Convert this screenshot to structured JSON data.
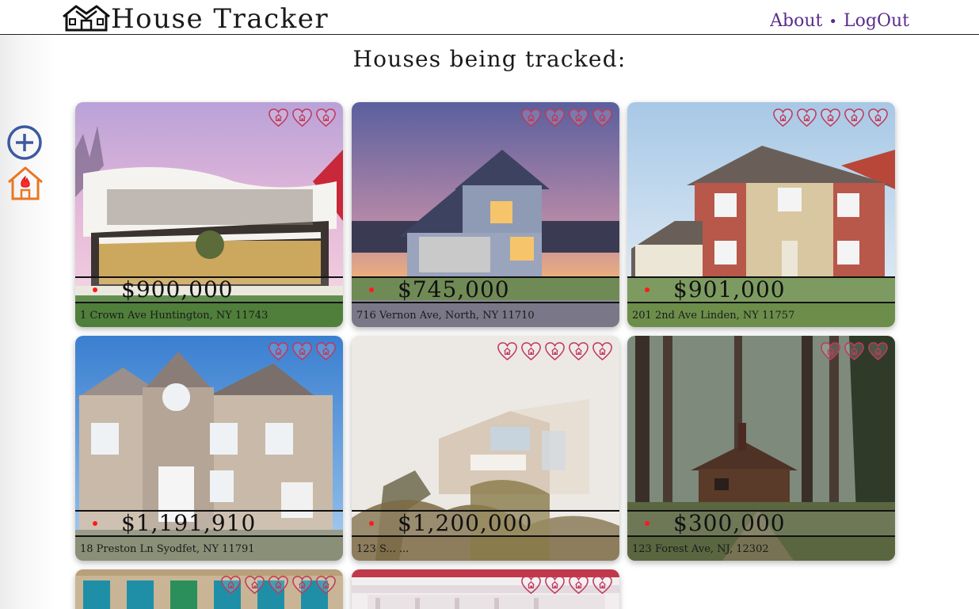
{
  "app": {
    "title": "House Tracker"
  },
  "nav": {
    "about": "About",
    "separator": "•",
    "logout": "LogOut"
  },
  "page_title": "Houses being tracked:",
  "side_buttons": {
    "add_icon": "plus-circle-icon",
    "fire_icon": "house-fire-icon"
  },
  "colors": {
    "nav": "#5a2e8a",
    "heart": "#c0395b",
    "dot": "#ff1a1a",
    "add_icon": "#3b5aa0",
    "fire_icon": "#e87722"
  },
  "houses": [
    {
      "price": "$900,000",
      "address": "1 Crown Ave Huntington, NY 11743",
      "hearts": 3
    },
    {
      "price": "$745,000",
      "address": "716 Vernon Ave, North, NY 11710",
      "hearts": 4
    },
    {
      "price": "$901,000",
      "address": "201 2nd Ave Linden, NY 11757",
      "hearts": 5
    },
    {
      "price": "$1,191,910",
      "address": "18 Preston Ln Syodfet, NY 11791",
      "hearts": 3
    },
    {
      "price": "$1,200,000",
      "address": "123 S... ...",
      "hearts": 5
    },
    {
      "price": "$300,000",
      "address": "123 Forest Ave, NJ, 12302",
      "hearts": 3
    },
    {
      "price": "",
      "address": "",
      "hearts": 5
    },
    {
      "price": "",
      "address": "",
      "hearts": 4
    }
  ]
}
